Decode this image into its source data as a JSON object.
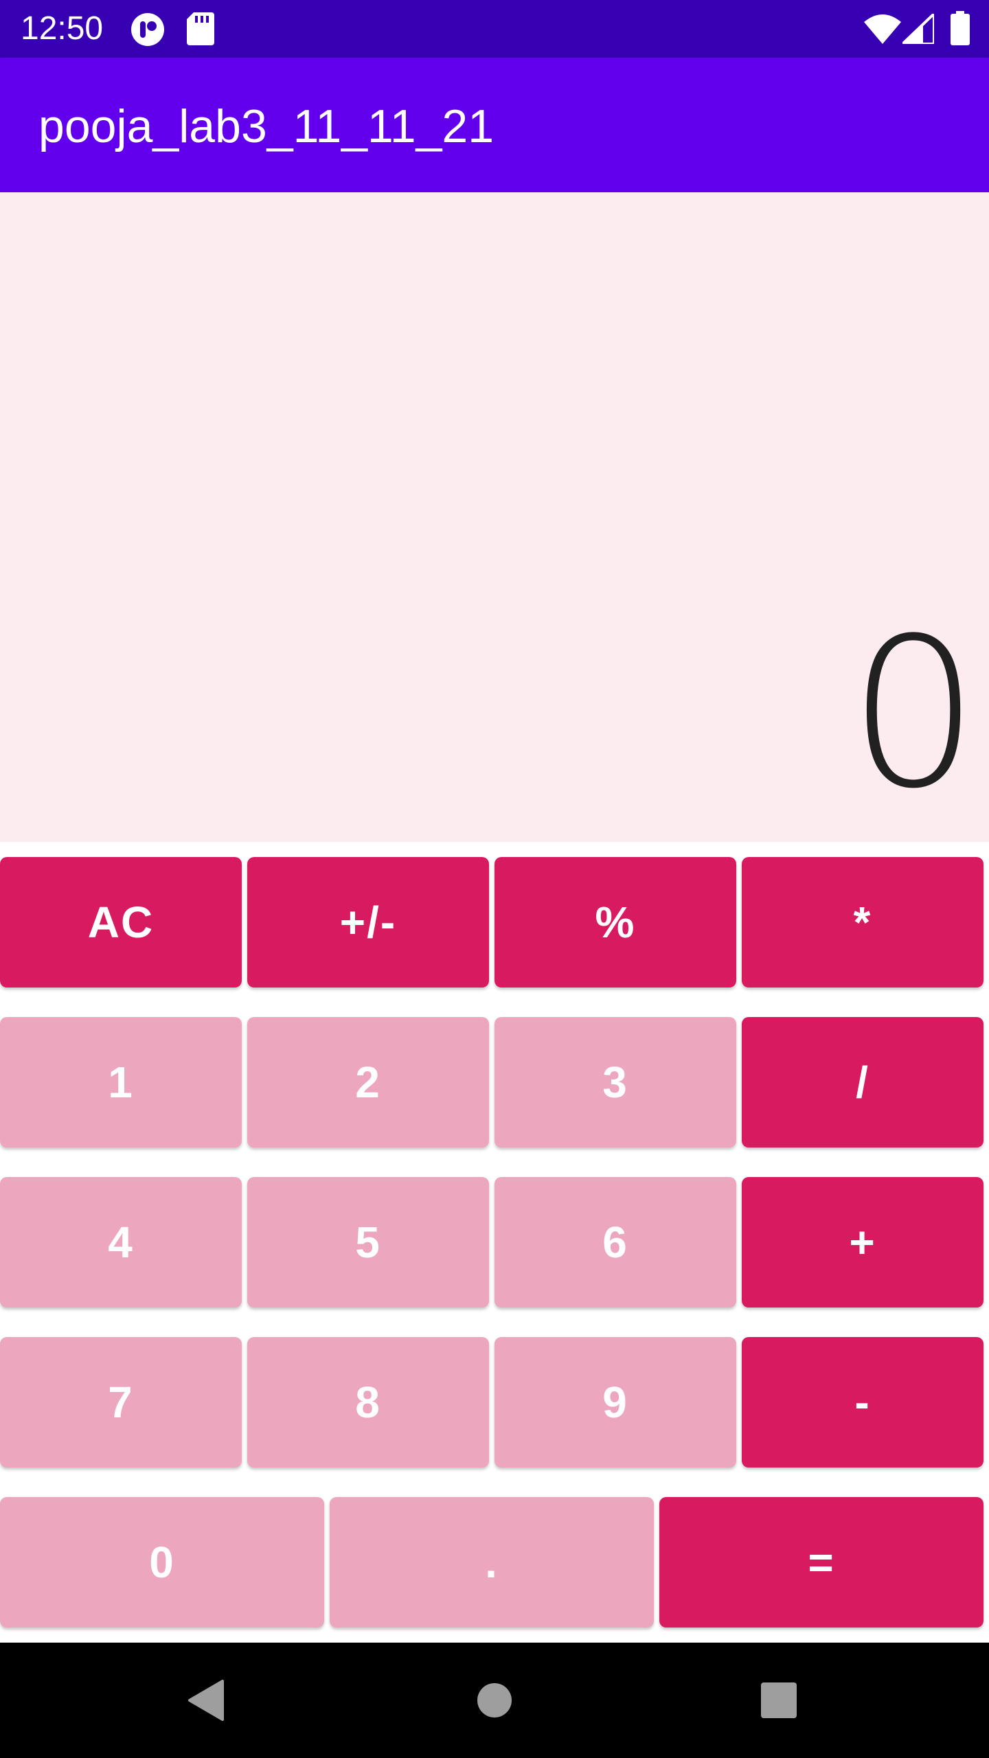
{
  "status_bar": {
    "time": "12:50",
    "icons": [
      "app-notification-icon",
      "sd-card-icon",
      "wifi-icon",
      "signal-icon",
      "battery-icon"
    ]
  },
  "app_bar": {
    "title": "pooja_lab3_11_11_21"
  },
  "display": {
    "value": "0"
  },
  "keypad": {
    "rows": [
      [
        {
          "label": "AC",
          "kind": "op"
        },
        {
          "label": "+/-",
          "kind": "op"
        },
        {
          "label": "%",
          "kind": "op"
        },
        {
          "label": "*",
          "kind": "op"
        }
      ],
      [
        {
          "label": "1",
          "kind": "num"
        },
        {
          "label": "2",
          "kind": "num"
        },
        {
          "label": "3",
          "kind": "num"
        },
        {
          "label": "/",
          "kind": "op"
        }
      ],
      [
        {
          "label": "4",
          "kind": "num"
        },
        {
          "label": "5",
          "kind": "num"
        },
        {
          "label": "6",
          "kind": "num"
        },
        {
          "label": "+",
          "kind": "op"
        }
      ],
      [
        {
          "label": "7",
          "kind": "num"
        },
        {
          "label": "8",
          "kind": "num"
        },
        {
          "label": "9",
          "kind": "num"
        },
        {
          "label": "-",
          "kind": "op"
        }
      ],
      [
        {
          "label": "0",
          "kind": "num"
        },
        {
          "label": ".",
          "kind": "num"
        },
        {
          "label": "=",
          "kind": "op"
        }
      ]
    ]
  },
  "colors": {
    "status_bar": "#3700B3",
    "app_bar": "#6200EE",
    "display_bg": "#FDECEF",
    "operator_button": "#D81B60",
    "number_button": "#ECA6BE",
    "nav_bar": "#000000"
  },
  "nav_bar": {
    "icons": [
      "back-icon",
      "home-icon",
      "recents-icon"
    ]
  }
}
